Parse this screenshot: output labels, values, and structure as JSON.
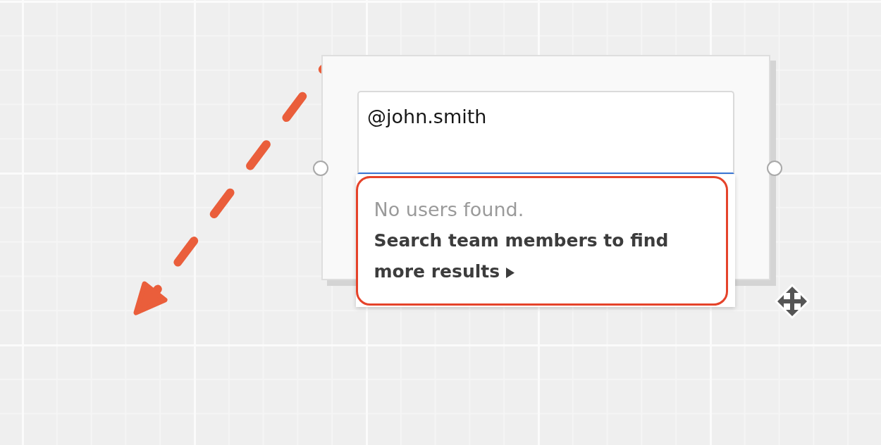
{
  "board": {
    "card": {
      "selected": true,
      "mention_input": {
        "value": "@john.smith",
        "focused": true
      },
      "suggestions": {
        "empty_message": "No users found.",
        "search_link": "Search team members to find more results"
      }
    }
  }
}
